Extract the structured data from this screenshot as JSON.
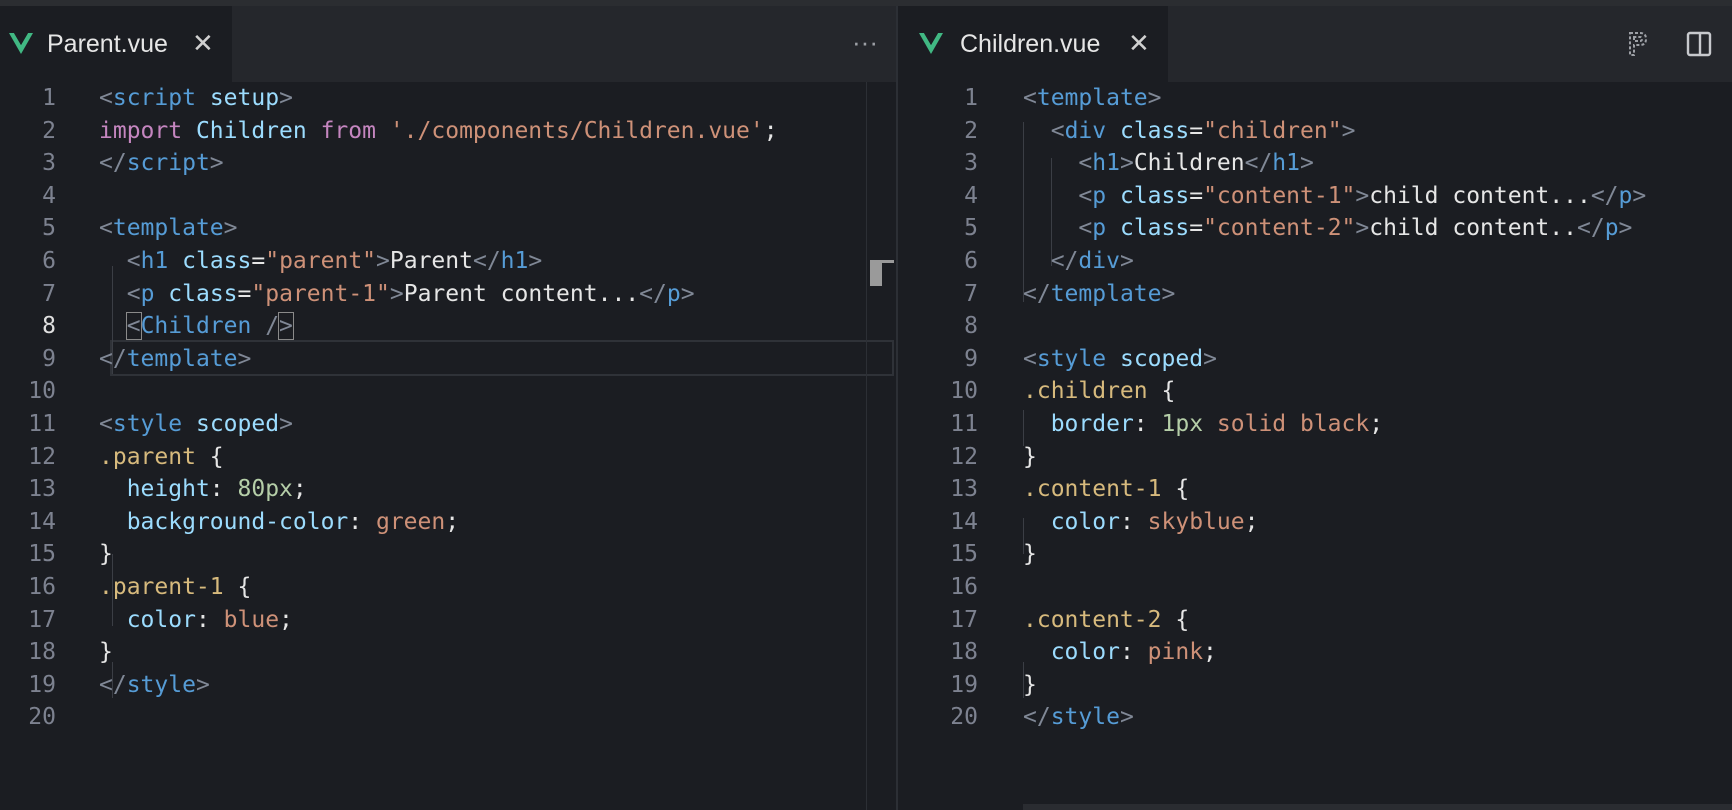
{
  "left_pane": {
    "tab": {
      "label": "Parent.vue",
      "close": "✕"
    },
    "more_actions": "···",
    "active_line": 8,
    "lines": [
      [
        [
          "<",
          "punct"
        ],
        [
          "script",
          "tag"
        ],
        [
          " ",
          "text"
        ],
        [
          "setup",
          "attr"
        ],
        [
          ">",
          "punct"
        ]
      ],
      [
        [
          "import",
          "kw"
        ],
        [
          " Children ",
          "attr"
        ],
        [
          "from",
          "kw"
        ],
        [
          " ",
          "text"
        ],
        [
          "'./components/Children.vue'",
          "str"
        ],
        [
          ";",
          "text"
        ]
      ],
      [
        [
          "</",
          "punct"
        ],
        [
          "script",
          "tag"
        ],
        [
          ">",
          "punct"
        ]
      ],
      [],
      [
        [
          "<",
          "punct"
        ],
        [
          "template",
          "tag"
        ],
        [
          ">",
          "punct"
        ]
      ],
      [
        [
          "  ",
          "text"
        ],
        [
          "<",
          "punct"
        ],
        [
          "h1",
          "tag"
        ],
        [
          " ",
          "text"
        ],
        [
          "class",
          "attr"
        ],
        [
          "=",
          "text"
        ],
        [
          "\"parent\"",
          "str"
        ],
        [
          ">",
          "punct"
        ],
        [
          "Parent",
          "text"
        ],
        [
          "</",
          "punct"
        ],
        [
          "h1",
          "tag"
        ],
        [
          ">",
          "punct"
        ]
      ],
      [
        [
          "  ",
          "text"
        ],
        [
          "<",
          "punct"
        ],
        [
          "p",
          "tag"
        ],
        [
          " ",
          "text"
        ],
        [
          "class",
          "attr"
        ],
        [
          "=",
          "text"
        ],
        [
          "\"parent-1\"",
          "str"
        ],
        [
          ">",
          "punct"
        ],
        [
          "Parent content...",
          "text"
        ],
        [
          "</",
          "punct"
        ],
        [
          "p",
          "tag"
        ],
        [
          ">",
          "punct"
        ]
      ],
      [
        [
          "  ",
          "text"
        ],
        [
          "<",
          "punct-box"
        ],
        [
          "Children",
          "tag"
        ],
        [
          " /",
          "punct"
        ],
        [
          ">",
          "punct-box"
        ]
      ],
      [
        [
          "</",
          "punct"
        ],
        [
          "template",
          "tag"
        ],
        [
          ">",
          "punct"
        ]
      ],
      [],
      [
        [
          "<",
          "punct"
        ],
        [
          "style",
          "tag"
        ],
        [
          " ",
          "text"
        ],
        [
          "scoped",
          "attr"
        ],
        [
          ">",
          "punct"
        ]
      ],
      [
        [
          ".parent",
          "sel"
        ],
        [
          " {",
          "brace"
        ]
      ],
      [
        [
          "  ",
          "text"
        ],
        [
          "height",
          "prop"
        ],
        [
          ": ",
          "text"
        ],
        [
          "80px",
          "num"
        ],
        [
          ";",
          "text"
        ]
      ],
      [
        [
          "  ",
          "text"
        ],
        [
          "background-color",
          "prop"
        ],
        [
          ": ",
          "text"
        ],
        [
          "green",
          "val"
        ],
        [
          ";",
          "text"
        ]
      ],
      [
        [
          "}",
          "brace"
        ]
      ],
      [
        [
          ".parent-1",
          "sel"
        ],
        [
          " {",
          "brace"
        ]
      ],
      [
        [
          "  ",
          "text"
        ],
        [
          "color",
          "prop"
        ],
        [
          ": ",
          "text"
        ],
        [
          "blue",
          "val"
        ],
        [
          ";",
          "text"
        ]
      ],
      [
        [
          "}",
          "brace"
        ]
      ],
      [
        [
          "</",
          "punct"
        ],
        [
          "style",
          "tag"
        ],
        [
          ">",
          "punct"
        ]
      ],
      []
    ]
  },
  "right_pane": {
    "tab": {
      "label": "Children.vue",
      "close": "✕"
    },
    "lines": [
      [
        [
          "<",
          "punct"
        ],
        [
          "template",
          "tag"
        ],
        [
          ">",
          "punct"
        ]
      ],
      [
        [
          "  ",
          "text"
        ],
        [
          "<",
          "punct"
        ],
        [
          "div",
          "tag"
        ],
        [
          " ",
          "text"
        ],
        [
          "class",
          "attr"
        ],
        [
          "=",
          "text"
        ],
        [
          "\"children\"",
          "str"
        ],
        [
          ">",
          "punct"
        ]
      ],
      [
        [
          "    ",
          "text"
        ],
        [
          "<",
          "punct"
        ],
        [
          "h1",
          "tag"
        ],
        [
          ">",
          "punct"
        ],
        [
          "Children",
          "text"
        ],
        [
          "</",
          "punct"
        ],
        [
          "h1",
          "tag"
        ],
        [
          ">",
          "punct"
        ]
      ],
      [
        [
          "    ",
          "text"
        ],
        [
          "<",
          "punct"
        ],
        [
          "p",
          "tag"
        ],
        [
          " ",
          "text"
        ],
        [
          "class",
          "attr"
        ],
        [
          "=",
          "text"
        ],
        [
          "\"content-1\"",
          "str"
        ],
        [
          ">",
          "punct"
        ],
        [
          "child content...",
          "text"
        ],
        [
          "</",
          "punct"
        ],
        [
          "p",
          "tag"
        ],
        [
          ">",
          "punct"
        ]
      ],
      [
        [
          "    ",
          "text"
        ],
        [
          "<",
          "punct"
        ],
        [
          "p",
          "tag"
        ],
        [
          " ",
          "text"
        ],
        [
          "class",
          "attr"
        ],
        [
          "=",
          "text"
        ],
        [
          "\"content-2\"",
          "str"
        ],
        [
          ">",
          "punct"
        ],
        [
          "child content..",
          "text"
        ],
        [
          "</",
          "punct"
        ],
        [
          "p",
          "tag"
        ],
        [
          ">",
          "punct"
        ]
      ],
      [
        [
          "  ",
          "text"
        ],
        [
          "</",
          "punct"
        ],
        [
          "div",
          "tag"
        ],
        [
          ">",
          "punct"
        ]
      ],
      [
        [
          "</",
          "punct"
        ],
        [
          "template",
          "tag"
        ],
        [
          ">",
          "punct"
        ]
      ],
      [],
      [
        [
          "<",
          "punct"
        ],
        [
          "style",
          "tag"
        ],
        [
          " ",
          "text"
        ],
        [
          "scoped",
          "attr"
        ],
        [
          ">",
          "punct"
        ]
      ],
      [
        [
          ".children",
          "sel"
        ],
        [
          " {",
          "brace"
        ]
      ],
      [
        [
          "  ",
          "text"
        ],
        [
          "border",
          "prop"
        ],
        [
          ": ",
          "text"
        ],
        [
          "1px",
          "num"
        ],
        [
          " ",
          "text"
        ],
        [
          "solid black",
          "val"
        ],
        [
          ";",
          "text"
        ]
      ],
      [
        [
          "}",
          "brace"
        ]
      ],
      [
        [
          ".content-1",
          "sel"
        ],
        [
          " {",
          "brace"
        ]
      ],
      [
        [
          "  ",
          "text"
        ],
        [
          "color",
          "prop"
        ],
        [
          ": ",
          "text"
        ],
        [
          "skyblue",
          "val"
        ],
        [
          ";",
          "text"
        ]
      ],
      [
        [
          "}",
          "brace"
        ]
      ],
      [],
      [
        [
          ".content-2",
          "sel"
        ],
        [
          " {",
          "brace"
        ]
      ],
      [
        [
          "  ",
          "text"
        ],
        [
          "color",
          "prop"
        ],
        [
          ": ",
          "text"
        ],
        [
          "pink",
          "val"
        ],
        [
          ";",
          "text"
        ]
      ],
      [
        [
          "}",
          "brace"
        ]
      ],
      [
        [
          "</",
          "punct"
        ],
        [
          "style",
          "tag"
        ],
        [
          ">",
          "punct"
        ]
      ]
    ]
  },
  "icons": {
    "vue": "vue-logo-icon",
    "more": "more-actions-icon",
    "preview": "open-preview-icon",
    "split": "split-editor-icon"
  },
  "colors": {
    "background": "#1b1d22",
    "tabbar": "#25272c",
    "tag": "#569cd6",
    "attribute": "#9cdcfe",
    "string": "#ce9178",
    "keyword": "#c586c0",
    "selector": "#d7ba7d",
    "number": "#b5cea8",
    "vue_green": "#41b883"
  }
}
